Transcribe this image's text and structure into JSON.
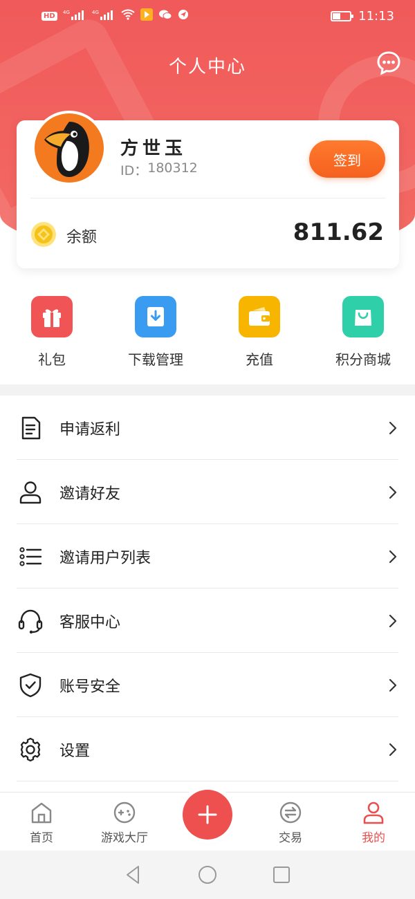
{
  "status_bar": {
    "network_labels": [
      "HD",
      "4G",
      "4G"
    ],
    "time": "11:13",
    "battery_level": 0.45
  },
  "header": {
    "title": "个人中心",
    "message_icon": "chat-bubble-icon"
  },
  "profile": {
    "name": "方世玉",
    "id_label": "ID：",
    "id_value": "180312",
    "checkin_label": "签到",
    "balance_label": "余额",
    "balance_value": "811.62",
    "avatar_icon": "toucan-avatar"
  },
  "quick_menu": [
    {
      "label": "礼包",
      "icon": "gift-icon",
      "color": "#f05454"
    },
    {
      "label": "下载管理",
      "icon": "download-icon",
      "color": "#3a9cf0"
    },
    {
      "label": "充值",
      "icon": "wallet-icon",
      "color": "#f7b500"
    },
    {
      "label": "积分商城",
      "icon": "shopping-bag-icon",
      "color": "#2fcfa9"
    }
  ],
  "menu_list": [
    {
      "label": "申请返利",
      "icon": "document-icon"
    },
    {
      "label": "邀请好友",
      "icon": "person-icon"
    },
    {
      "label": "邀请用户列表",
      "icon": "list-icon"
    },
    {
      "label": "客服中心",
      "icon": "headset-icon"
    },
    {
      "label": "账号安全",
      "icon": "shield-icon"
    },
    {
      "label": "设置",
      "icon": "gear-icon"
    }
  ],
  "tab_bar": {
    "tabs": [
      {
        "label": "首页",
        "icon": "home-icon"
      },
      {
        "label": "游戏大厅",
        "icon": "gamepad-icon"
      },
      {
        "label": "交易",
        "icon": "exchange-icon"
      },
      {
        "label": "我的",
        "icon": "user-icon",
        "active": true
      }
    ],
    "center_icon": "plus-icon",
    "active_color": "#e8504f"
  },
  "colors": {
    "brand_red": "#f05a5a",
    "checkin_orange": "#f5611f"
  }
}
